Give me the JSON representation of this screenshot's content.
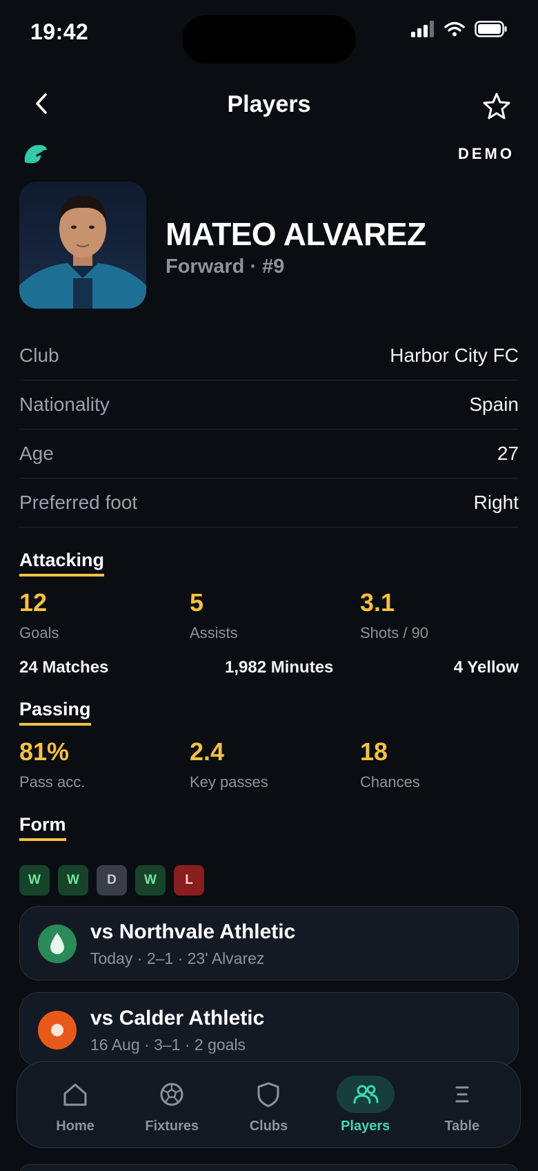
{
  "status": {
    "time": "19:42"
  },
  "nav": {
    "title": "Players",
    "badge": "DEMO"
  },
  "player": {
    "name": "MATEO ALVAREZ",
    "subtitle": "Forward · #9"
  },
  "info": [
    {
      "label": "Club",
      "value": "Harbor City FC"
    },
    {
      "label": "Nationality",
      "value": "Spain"
    },
    {
      "label": "Age",
      "value": "27"
    },
    {
      "label": "Preferred foot",
      "value": "Right"
    }
  ],
  "attacking": {
    "title": "Attacking",
    "stats": [
      {
        "value": "12",
        "label": "Goals"
      },
      {
        "value": "5",
        "label": "Assists"
      },
      {
        "value": "3.1",
        "label": "Shots / 90"
      }
    ],
    "meta": [
      "24 Matches",
      "1,982 Minutes",
      "4 Yellow"
    ]
  },
  "passing": {
    "title": "Passing",
    "stats": [
      {
        "value": "81%",
        "label": "Pass acc."
      },
      {
        "value": "2.4",
        "label": "Key passes"
      },
      {
        "value": "18",
        "label": "Chances"
      }
    ]
  },
  "form": {
    "title": "Form",
    "results": [
      "W",
      "W",
      "D",
      "W",
      "L"
    ]
  },
  "matches": [
    {
      "title": "vs Northvale Athletic",
      "sub": "Today · 2–1 · 23' Alvarez",
      "color": "#2a8a58"
    },
    {
      "title": "vs Calder Athletic",
      "sub": "16 Aug · 3–1 · 2 goals",
      "color": "#e85a1c"
    }
  ],
  "tabs": [
    {
      "label": "Home",
      "icon": "home-icon"
    },
    {
      "label": "Fixtures",
      "icon": "ball-icon"
    },
    {
      "label": "Clubs",
      "icon": "shield-icon"
    },
    {
      "label": "Players",
      "icon": "players-icon",
      "active": true
    },
    {
      "label": "Table",
      "icon": "table-icon"
    }
  ],
  "colors": {
    "accent": "#f5c042",
    "active_tab": "#3fd6b3",
    "background": "#0a0d12"
  }
}
